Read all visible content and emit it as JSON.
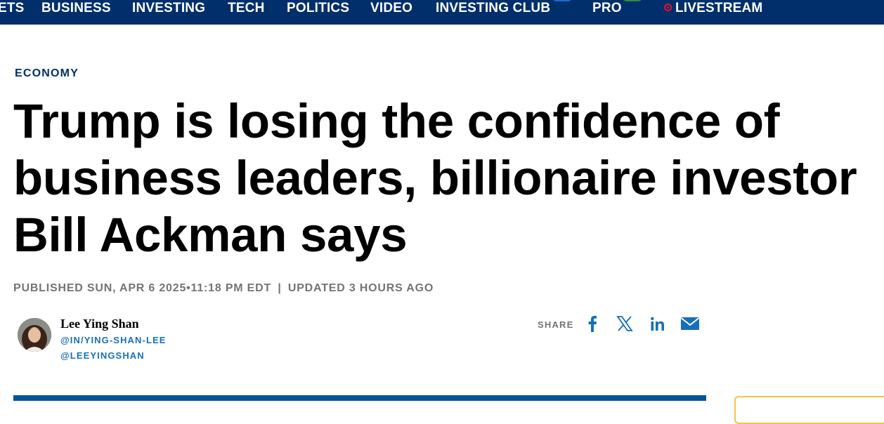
{
  "nav": {
    "items": [
      "ETS",
      "BUSINESS",
      "INVESTING",
      "TECH",
      "POLITICS",
      "VIDEO",
      "INVESTING CLUB",
      "PRO",
      "LIVESTREAM"
    ]
  },
  "article": {
    "kicker": "ECONOMY",
    "headline": "Trump is losing the confidence of business leaders, billionaire investor Bill Ackman says",
    "published": "PUBLISHED SUN, APR 6 2025•11:18 PM EDT",
    "separator": "|",
    "updated": "UPDATED 3 HOURS AGO"
  },
  "author": {
    "name": "Lee Ying Shan",
    "linkedin": "@IN/YING-SHAN-LEE",
    "twitter": "@LEEYINGSHAN"
  },
  "share": {
    "label": "SHARE",
    "icons": [
      "facebook-icon",
      "x-icon",
      "linkedin-icon",
      "email-icon"
    ]
  },
  "colors": {
    "nav_bg": "#002f6c",
    "kicker": "#002f6c",
    "link": "#176fbc",
    "rule": "#005594",
    "live": "#e8112d"
  }
}
